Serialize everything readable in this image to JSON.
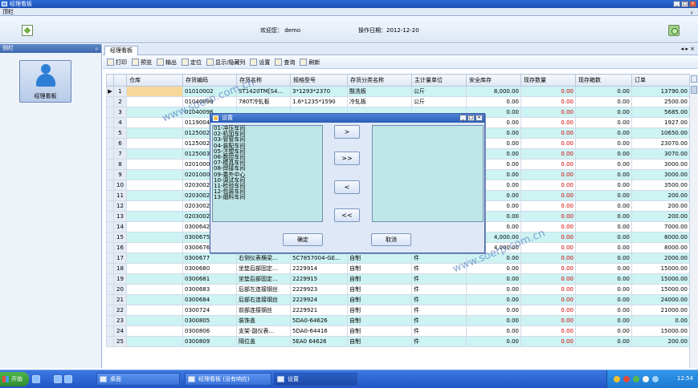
{
  "window": {
    "title": "经理看板"
  },
  "topbar": {
    "label": "顶栏",
    "pin": "ₚ"
  },
  "header": {
    "welcome": "欢迎您： demo",
    "op_date": "操作日期：2012-12-20"
  },
  "sidebar": {
    "title": "侧栏",
    "pin": "ₚ",
    "button_label": "经理看板"
  },
  "tabs": {
    "active": "经理看板",
    "nav": "◂ ▸ ×"
  },
  "toolbar": {
    "print": "打印",
    "preview": "预览",
    "export": "输出",
    "locate": "定位",
    "show_hide": "显示/隐藏列",
    "settings": "设置",
    "query": "查询",
    "refresh": "刷新"
  },
  "grid": {
    "columns": [
      "仓库",
      "存货编码",
      "存货名称",
      "规格型号",
      "存货分类名称",
      "主计量单位",
      "安全库存",
      "现存数量",
      "现存箱数",
      "订单"
    ],
    "rows": [
      {
        "n": "1",
        "code": "01010002",
        "name": "ST1420TM[S4…",
        "spec": "3*1293*2370",
        "cat": "酸洗板",
        "unit": "公斤",
        "safe": "8,000.00",
        "qty": "0.00",
        "box": "0.00",
        "order": "13790.00"
      },
      {
        "n": "2",
        "code": "01040090",
        "name": "780T冷轧板",
        "spec": "1.6*1235*1590",
        "cat": "冷轧板",
        "unit": "公斤",
        "safe": "0.00",
        "qty": "0.00",
        "box": "0.00",
        "order": "2500.00"
      },
      {
        "n": "3",
        "code": "01040096",
        "name": "",
        "spec": "",
        "cat": "",
        "unit": "",
        "safe": "0.00",
        "qty": "0.00",
        "box": "0.00",
        "order": "5685.00"
      },
      {
        "n": "4",
        "code": "01190040",
        "name": "",
        "spec": "",
        "cat": "",
        "unit": "",
        "safe": "0.00",
        "qty": "0.00",
        "box": "0.00",
        "order": "1927.00"
      },
      {
        "n": "5",
        "code": "01250028",
        "name": "",
        "spec": "",
        "cat": "",
        "unit": "",
        "safe": "0.00",
        "qty": "0.00",
        "box": "0.00",
        "order": "10650.00"
      },
      {
        "n": "6",
        "code": "01250029",
        "name": "",
        "spec": "",
        "cat": "",
        "unit": "",
        "safe": "0.00",
        "qty": "0.00",
        "box": "0.00",
        "order": "23070.00"
      },
      {
        "n": "7",
        "code": "01250030",
        "name": "",
        "spec": "",
        "cat": "",
        "unit": "",
        "safe": "0.00",
        "qty": "0.00",
        "box": "0.00",
        "order": "3070.00"
      },
      {
        "n": "8",
        "code": "02010007",
        "name": "",
        "spec": "",
        "cat": "",
        "unit": "",
        "safe": "0.00",
        "qty": "0.00",
        "box": "0.00",
        "order": "3000.00"
      },
      {
        "n": "9",
        "code": "02010007",
        "name": "",
        "spec": "",
        "cat": "",
        "unit": "",
        "safe": "0.00",
        "qty": "0.00",
        "box": "0.00",
        "order": "3000.00"
      },
      {
        "n": "10",
        "code": "02030020",
        "name": "",
        "spec": "",
        "cat": "",
        "unit": "",
        "safe": "0.00",
        "qty": "0.00",
        "box": "0.00",
        "order": "3500.00"
      },
      {
        "n": "11",
        "code": "02030020",
        "name": "",
        "spec": "",
        "cat": "",
        "unit": "",
        "safe": "0.00",
        "qty": "0.00",
        "box": "0.00",
        "order": "200.00"
      },
      {
        "n": "12",
        "code": "02030020",
        "name": "",
        "spec": "",
        "cat": "",
        "unit": "",
        "safe": "0.00",
        "qty": "0.00",
        "box": "0.00",
        "order": "200.00"
      },
      {
        "n": "13",
        "code": "02030020",
        "name": "",
        "spec": "",
        "cat": "",
        "unit": "",
        "safe": "0.00",
        "qty": "0.00",
        "box": "0.00",
        "order": "200.00"
      },
      {
        "n": "14",
        "code": "0300642",
        "name": "",
        "spec": "",
        "cat": "",
        "unit": "",
        "safe": "0.00",
        "qty": "0.00",
        "box": "0.00",
        "order": "7000.00"
      },
      {
        "n": "15",
        "code": "0300675",
        "name": "",
        "spec": "",
        "cat": "",
        "unit": "",
        "safe": "4,000.00",
        "qty": "0.00",
        "box": "0.00",
        "order": "8000.00"
      },
      {
        "n": "16",
        "code": "0300676",
        "name": "",
        "spec": "",
        "cat": "",
        "unit": "",
        "safe": "4,000.00",
        "qty": "0.00",
        "box": "0.00",
        "order": "8000.00"
      },
      {
        "n": "17",
        "code": "0300677",
        "name": "右侧仪表横梁…",
        "spec": "5C7857004-GE…",
        "cat": "自制",
        "unit": "件",
        "safe": "0.00",
        "qty": "0.00",
        "box": "0.00",
        "order": "2000.00"
      },
      {
        "n": "18",
        "code": "0300680",
        "name": "坐垫后部固定…",
        "spec": "2229914",
        "cat": "自制",
        "unit": "件",
        "safe": "0.00",
        "qty": "0.00",
        "box": "0.00",
        "order": "15000.00"
      },
      {
        "n": "19",
        "code": "0300681",
        "name": "坐垫后部固定…",
        "spec": "2229915",
        "cat": "自制",
        "unit": "件",
        "safe": "0.00",
        "qty": "0.00",
        "box": "0.00",
        "order": "15000.00"
      },
      {
        "n": "20",
        "code": "0300683",
        "name": "后部左连接钢丝",
        "spec": "2229923",
        "cat": "自制",
        "unit": "件",
        "safe": "0.00",
        "qty": "0.00",
        "box": "0.00",
        "order": "15000.00"
      },
      {
        "n": "21",
        "code": "0300684",
        "name": "后部右连接钢丝",
        "spec": "2229924",
        "cat": "自制",
        "unit": "件",
        "safe": "0.00",
        "qty": "0.00",
        "box": "0.00",
        "order": "24000.00"
      },
      {
        "n": "22",
        "code": "0300724",
        "name": "前部连接钢丝",
        "spec": "2229921",
        "cat": "自制",
        "unit": "件",
        "safe": "0.00",
        "qty": "0.00",
        "box": "0.00",
        "order": "21000.00"
      },
      {
        "n": "23",
        "code": "0300805",
        "name": "装饰盖",
        "spec": "5DA0-64626",
        "cat": "自制",
        "unit": "件",
        "safe": "0.00",
        "qty": "0.00",
        "box": "0.00",
        "order": "0.00"
      },
      {
        "n": "24",
        "code": "0300806",
        "name": "支架-副仪表…",
        "spec": "5DA0-64416",
        "cat": "自制",
        "unit": "件",
        "safe": "0.00",
        "qty": "0.00",
        "box": "0.00",
        "order": "15000.00"
      },
      {
        "n": "25",
        "code": "0300809",
        "name": "隔位盖",
        "spec": "5EA0 64626",
        "cat": "自制",
        "unit": "件",
        "safe": "0.00",
        "qty": "0.00",
        "box": "0.00",
        "order": "200.00"
      }
    ]
  },
  "dialog": {
    "title": "设置",
    "items": [
      "01-冲压车间",
      "02-机加车间",
      "03-管管车间",
      "04-装配车间",
      "05-注塑车间",
      "06-数控车间",
      "07-模具车间",
      "08-焊接车间",
      "09-委外中心",
      "10-调试车间",
      "11-检验车间",
      "12-包装车间",
      "13-烟料车间"
    ],
    "btn_add": ">",
    "btn_add_all": ">>",
    "btn_remove": "<",
    "btn_remove_all": "<<",
    "ok": "确定",
    "cancel": "取消"
  },
  "taskbar": {
    "start": "开始",
    "desktop": "桌面",
    "task1": "经理看板 (没有响应)",
    "task2": "设置",
    "clock": "12:54"
  },
  "watermark": "www.soerp.com.cn"
}
